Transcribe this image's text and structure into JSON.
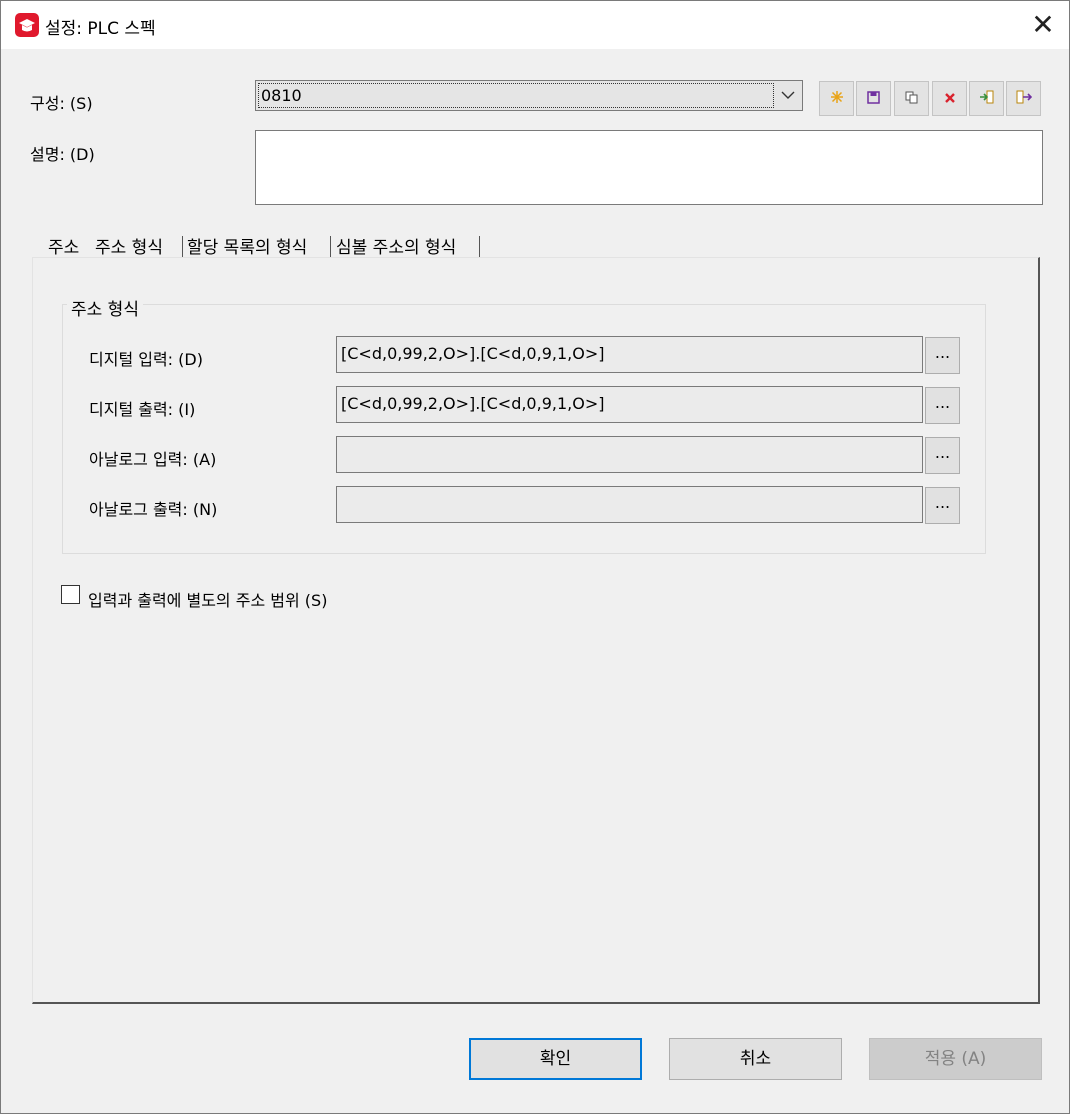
{
  "window": {
    "title": "설정: PLC 스펙",
    "close_glyph": "✕",
    "app_icon": "app-logo-icon",
    "accent_color": "#e0192d"
  },
  "config": {
    "label": "구성: (S)",
    "value": "0810",
    "toolbar": [
      {
        "icon": "new-icon",
        "color": "#e8a317"
      },
      {
        "icon": "save-icon",
        "color": "#7030a0"
      },
      {
        "icon": "copy-icon",
        "color": "#555555"
      },
      {
        "icon": "delete-icon",
        "color": "#d9232e"
      },
      {
        "icon": "import-icon",
        "color": "#3a8f3a"
      },
      {
        "icon": "export-icon",
        "color": "#7030a0"
      }
    ]
  },
  "description": {
    "label": "설명: (D)",
    "value": ""
  },
  "tabs": [
    {
      "label": "주소"
    },
    {
      "label": "주소 형식",
      "selected": true
    },
    {
      "label": "할당 목록의 형식"
    },
    {
      "label": "심볼 주소의 형식"
    }
  ],
  "address_format": {
    "group_title": "주소 형식",
    "rows": [
      {
        "label": "디지털 입력: (D)",
        "value": "[C<d,0,99,2,O>].[C<d,0,9,1,O>]",
        "button": "..."
      },
      {
        "label": "디지털 출력: (I)",
        "value": "[C<d,0,99,2,O>].[C<d,0,9,1,O>]",
        "button": "..."
      },
      {
        "label": "아날로그 입력: (A)",
        "value": "",
        "button": "..."
      },
      {
        "label": "아날로그 출력: (N)",
        "value": "",
        "button": "..."
      }
    ]
  },
  "separate_range": {
    "label": "입력과 출력에 별도의 주소 범위 (S)",
    "checked": false
  },
  "buttons": {
    "ok": "확인",
    "cancel": "취소",
    "apply": "적용 (A)"
  }
}
